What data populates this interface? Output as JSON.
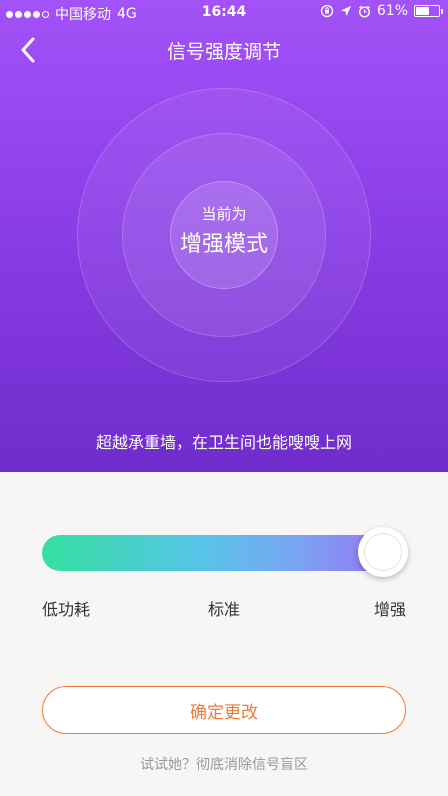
{
  "status_bar": {
    "carrier": "中国移动",
    "network": "4G",
    "time": "16:44",
    "battery": "61%",
    "battery_level": 0.61
  },
  "nav": {
    "title": "信号强度调节"
  },
  "hero": {
    "mode_label": "当前为",
    "mode_value": "增强模式",
    "caption": "超越承重墙，在卫生间也能嗖嗖上网"
  },
  "slider": {
    "labels": [
      "低功耗",
      "标准",
      "增强"
    ],
    "selected_index": 2,
    "position": 1.0
  },
  "actions": {
    "confirm_label": "确定更改",
    "footer_link": "试试她？彻底消除信号盲区"
  },
  "colors": {
    "accent": "#f07a3a",
    "hero_top": "#a352f7",
    "hero_bottom": "#6f2ccb",
    "slider_start": "#34e0a1",
    "slider_end": "#9b6cf2"
  }
}
